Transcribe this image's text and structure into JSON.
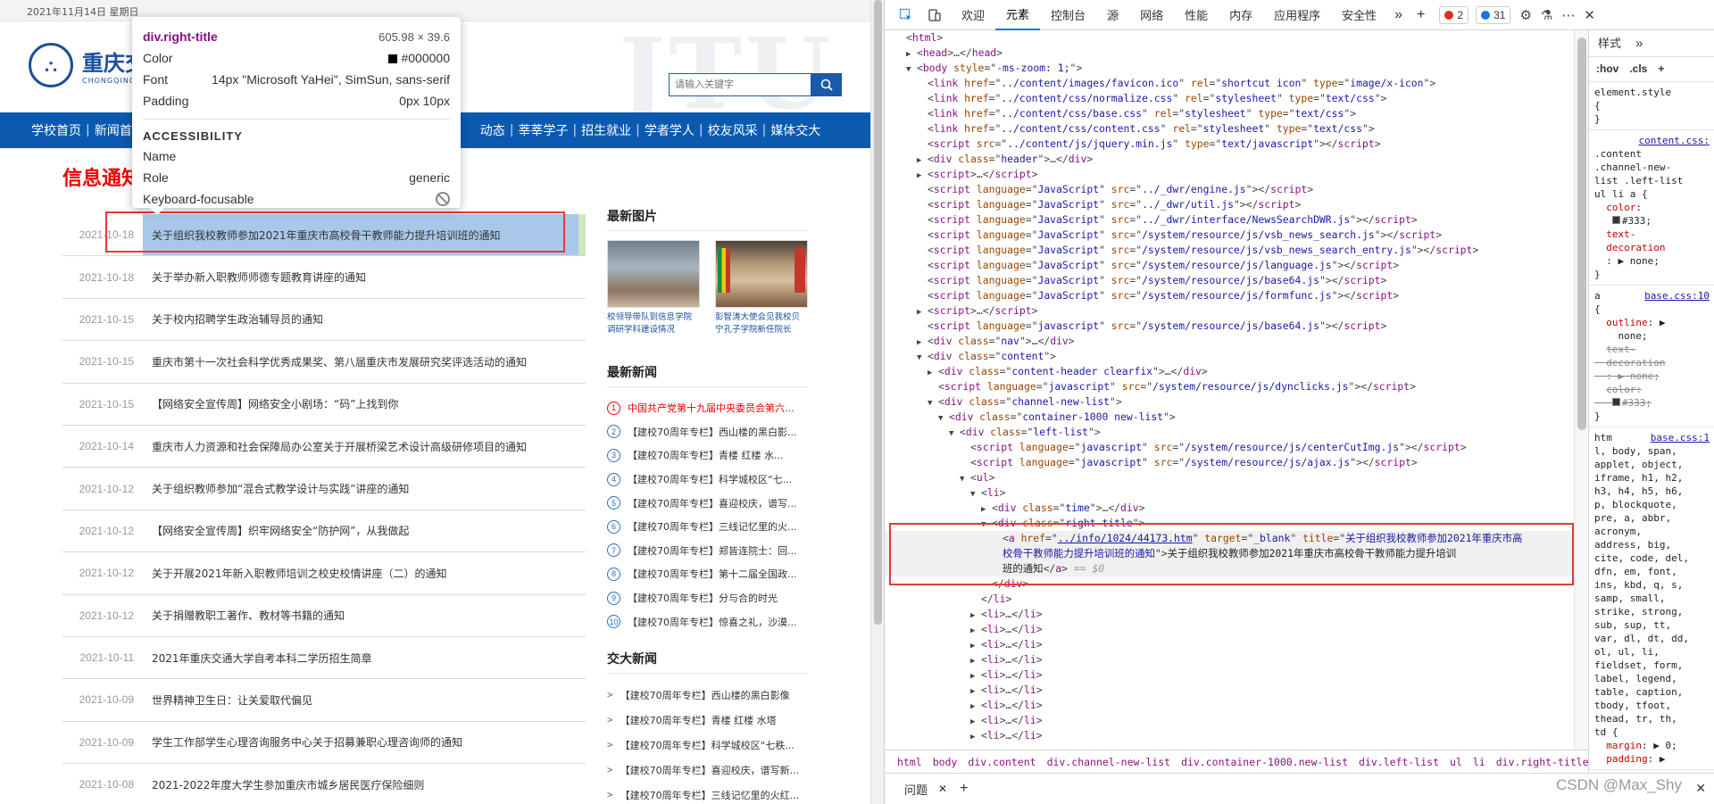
{
  "site": {
    "date": "2021年11月14日 星期日",
    "logo_cn": "重庆交通大学",
    "logo_en": "CHONGQING JIAOTONG UNIVERSITY",
    "bgtext": "JTU",
    "search_placeholder": "请输入关键字",
    "nav": [
      "学校首页",
      "新闻首页",
      "动态",
      "莘莘学子",
      "招生就业",
      "学者学人",
      "校友风采",
      "媒体交大"
    ],
    "section_title": "信息通知",
    "list": [
      {
        "time": "2021-10-18",
        "title": "关于组织我校教师参加2021年重庆市高校骨干教师能力提升培训班的通知"
      },
      {
        "time": "2021-10-18",
        "title": "关于举办新入职教师师德专题教育讲座的通知"
      },
      {
        "time": "2021-10-15",
        "title": "关于校内招聘学生政治辅导员的通知"
      },
      {
        "time": "2021-10-15",
        "title": "重庆市第十一次社会科学优秀成果奖、第八届重庆市发展研究奖评选活动的通知"
      },
      {
        "time": "2021-10-15",
        "title": "【网络安全宣传周】网络安全小剧场：“码”上找到你"
      },
      {
        "time": "2021-10-14",
        "title": "重庆市人力资源和社会保障局办公室关于开展桥梁艺术设计高级研修项目的通知"
      },
      {
        "time": "2021-10-12",
        "title": "关于组织教师参加“混合式教学设计与实践”讲座的通知"
      },
      {
        "time": "2021-10-12",
        "title": "【网络安全宣传周】织牢网络安全“防护网”，从我做起"
      },
      {
        "time": "2021-10-12",
        "title": "关于开展2021年新入职教师培训之校史校情讲座（二）的通知"
      },
      {
        "time": "2021-10-12",
        "title": "关于捐赠教职工著作、教材等书籍的通知"
      },
      {
        "time": "2021-10-11",
        "title": "2021年重庆交通大学自考本科二学历招生简章"
      },
      {
        "time": "2021-10-09",
        "title": "世界精神卫生日：让关爱取代偏见"
      },
      {
        "time": "2021-10-09",
        "title": "学生工作部学生心理咨询服务中心关于招募兼职心理咨询师的通知"
      },
      {
        "time": "2021-10-08",
        "title": "2021-2022年度大学生参加重庆市城乡居民医疗保险细则"
      }
    ],
    "pics_title": "最新图片",
    "pics": [
      {
        "caption": "校领导带队到信息学院调研学科建设情况"
      },
      {
        "caption": "彭智涛大使会见我校贝宁孔子学院新任院长"
      }
    ],
    "news_title": "最新新闻",
    "news": [
      {
        "num": "1",
        "text": "中国共产党第十九届中央委员会第六..."
      },
      {
        "num": "2",
        "text": "【建校70周年专栏】西山楼的黑白影..."
      },
      {
        "num": "3",
        "text": "【建校70周年专栏】青楼 红楼 水..."
      },
      {
        "num": "4",
        "text": "【建校70周年专栏】科学城校区“七..."
      },
      {
        "num": "5",
        "text": "【建校70周年专栏】喜迎校庆，谱写..."
      },
      {
        "num": "6",
        "text": "【建校70周年专栏】三线记忆里的火..."
      },
      {
        "num": "7",
        "text": "【建校70周年专栏】郑皆连院士：回..."
      },
      {
        "num": "8",
        "text": "【建校70周年专栏】第十二届全国政..."
      },
      {
        "num": "9",
        "text": "【建校70周年专栏】分与合的时光"
      },
      {
        "num": "10",
        "text": "【建校70周年专栏】惊喜之礼，沙漠..."
      }
    ],
    "jd_title": "交大新闻",
    "jd": [
      "【建校70周年专栏】西山楼的黑白影像",
      "【建校70周年专栏】青楼 红楼 水塔",
      "【建校70周年专栏】科学城校区“七秩...",
      "【建校70周年专栏】喜迎校庆，谱写新...",
      "【建校70周年专栏】三线记忆里的火红..."
    ]
  },
  "tooltip": {
    "tag": "div.right-title",
    "dims": "605.98 × 39.6",
    "color_label": "Color",
    "color_value": "#000000",
    "font_label": "Font",
    "font_value": "14px \"Microsoft YaHei\", SimSun, sans-serif",
    "padding_label": "Padding",
    "padding_value": "0px 10px",
    "acc_title": "ACCESSIBILITY",
    "name_label": "Name",
    "role_label": "Role",
    "role_value": "generic",
    "kf_label": "Keyboard-focusable"
  },
  "devtools": {
    "tabs": [
      "欢迎",
      "元素",
      "控制台",
      "源",
      "网络",
      "性能",
      "内存",
      "应用程序",
      "安全性"
    ],
    "active_tab": "元素",
    "errors": "2",
    "messages": "31",
    "styles_tab": "样式",
    "filters": [
      ":hov",
      ".cls"
    ],
    "breadcrumbs": [
      "html",
      "body",
      "div.content",
      "div.channel-new-list",
      "div.container-1000.new-list",
      "div.left-list",
      "ul",
      "li",
      "div.right-title",
      "a"
    ],
    "drawer_tab": "问题",
    "watermark": "CSDN @Max_Shy",
    "dom": [
      {
        "i": 0,
        "h": "&lt;<span class='tagn'>html</span>&gt;"
      },
      {
        "i": 1,
        "t": "▶",
        "h": "&lt;<span class='tagn'>head</span>&gt;…&lt;/<span class='tagn'>head</span>&gt;"
      },
      {
        "i": 1,
        "t": "▼",
        "h": "&lt;<span class='tagn'>body</span> <span class='attr'>style</span>=\"<span class='val'>-ms-zoom: 1;</span>\"&gt;"
      },
      {
        "i": 2,
        "h": "&lt;<span class='tagn'>link</span> <span class='attr'>href</span>=\"<span class='val'>../content/images/favicon.ico</span>\" <span class='attr'>rel</span>=\"<span class='val'>shortcut icon</span>\" <span class='attr'>type</span>=\"<span class='val'>image/x-icon</span>\"&gt;"
      },
      {
        "i": 2,
        "h": "&lt;<span class='tagn'>link</span> <span class='attr'>href</span>=\"<span class='val'>../content/css/normalize.css</span>\" <span class='attr'>rel</span>=\"<span class='val'>stylesheet</span>\" <span class='attr'>type</span>=\"<span class='val'>text/css</span>\"&gt;"
      },
      {
        "i": 2,
        "h": "&lt;<span class='tagn'>link</span> <span class='attr'>href</span>=\"<span class='val'>../content/css/base.css</span>\" <span class='attr'>rel</span>=\"<span class='val'>stylesheet</span>\" <span class='attr'>type</span>=\"<span class='val'>text/css</span>\"&gt;"
      },
      {
        "i": 2,
        "h": "&lt;<span class='tagn'>link</span> <span class='attr'>href</span>=\"<span class='val'>../content/css/content.css</span>\" <span class='attr'>rel</span>=\"<span class='val'>stylesheet</span>\" <span class='attr'>type</span>=\"<span class='val'>text/css</span>\"&gt;"
      },
      {
        "i": 2,
        "h": "&lt;<span class='tagn'>script</span> <span class='attr'>src</span>=\"<span class='val'>../content/js/jquery.min.js</span>\" <span class='attr'>type</span>=\"<span class='val'>text/javascript</span>\"&gt;&lt;/<span class='tagn'>script</span>&gt;"
      },
      {
        "i": 2,
        "t": "▶",
        "h": "&lt;<span class='tagn'>div</span> <span class='attr'>class</span>=\"<span class='val'>header</span>\"&gt;…&lt;/<span class='tagn'>div</span>&gt;"
      },
      {
        "i": 2,
        "t": "▶",
        "h": "&lt;<span class='tagn'>script</span>&gt;…&lt;/<span class='tagn'>script</span>&gt;"
      },
      {
        "i": 2,
        "h": "&lt;<span class='tagn'>script</span> <span class='attr'>language</span>=\"<span class='val'>JavaScript</span>\" <span class='attr'>src</span>=\"<span class='val'>../_dwr/engine.js</span>\"&gt;&lt;/<span class='tagn'>script</span>&gt;"
      },
      {
        "i": 2,
        "h": "&lt;<span class='tagn'>script</span> <span class='attr'>language</span>=\"<span class='val'>JavaScript</span>\" <span class='attr'>src</span>=\"<span class='val'>../_dwr/util.js</span>\"&gt;&lt;/<span class='tagn'>script</span>&gt;"
      },
      {
        "i": 2,
        "h": "&lt;<span class='tagn'>script</span> <span class='attr'>language</span>=\"<span class='val'>JavaScript</span>\" <span class='attr'>src</span>=\"<span class='val'>../_dwr/interface/NewsSearchDWR.js</span>\"&gt;&lt;/<span class='tagn'>script</span>&gt;"
      },
      {
        "i": 2,
        "h": "&lt;<span class='tagn'>script</span> <span class='attr'>language</span>=\"<span class='val'>JavaScript</span>\" <span class='attr'>src</span>=\"<span class='val'>/system/resource/js/vsb_news_search.js</span>\"&gt;&lt;/<span class='tagn'>script</span>&gt;"
      },
      {
        "i": 2,
        "h": "&lt;<span class='tagn'>script</span> <span class='attr'>language</span>=\"<span class='val'>JavaScript</span>\" <span class='attr'>src</span>=\"<span class='val'>/system/resource/js/vsb_news_search_entry.js</span>\"&gt;&lt;/<span class='tagn'>script</span>&gt;"
      },
      {
        "i": 2,
        "h": "&lt;<span class='tagn'>script</span> <span class='attr'>language</span>=\"<span class='val'>JavaScript</span>\" <span class='attr'>src</span>=\"<span class='val'>/system/resource/js/language.js</span>\"&gt;&lt;/<span class='tagn'>script</span>&gt;"
      },
      {
        "i": 2,
        "h": "&lt;<span class='tagn'>script</span> <span class='attr'>language</span>=\"<span class='val'>JavaScript</span>\" <span class='attr'>src</span>=\"<span class='val'>/system/resource/js/base64.js</span>\"&gt;&lt;/<span class='tagn'>script</span>&gt;"
      },
      {
        "i": 2,
        "h": "&lt;<span class='tagn'>script</span> <span class='attr'>language</span>=\"<span class='val'>JavaScript</span>\" <span class='attr'>src</span>=\"<span class='val'>/system/resource/js/formfunc.js</span>\"&gt;&lt;/<span class='tagn'>script</span>&gt;"
      },
      {
        "i": 2,
        "t": "▶",
        "h": "&lt;<span class='tagn'>script</span>&gt;…&lt;/<span class='tagn'>script</span>&gt;"
      },
      {
        "i": 2,
        "h": "&lt;<span class='tagn'>script</span> <span class='attr'>language</span>=\"<span class='val'>javascript</span>\" <span class='attr'>src</span>=\"<span class='val'>/system/resource/js/base64.js</span>\"&gt;&lt;/<span class='tagn'>script</span>&gt;"
      },
      {
        "i": 2,
        "t": "▶",
        "h": "&lt;<span class='tagn'>div</span> <span class='attr'>class</span>=\"<span class='val'>nav</span>\"&gt;…&lt;/<span class='tagn'>div</span>&gt;"
      },
      {
        "i": 2,
        "t": "▼",
        "h": "&lt;<span class='tagn'>div</span> <span class='attr'>class</span>=\"<span class='val'>content</span>\"&gt;"
      },
      {
        "i": 3,
        "t": "▶",
        "h": "&lt;<span class='tagn'>div</span> <span class='attr'>class</span>=\"<span class='val'>content-header clearfix</span>\"&gt;…&lt;/<span class='tagn'>div</span>&gt;"
      },
      {
        "i": 3,
        "h": "&lt;<span class='tagn'>script</span> <span class='attr'>language</span>=\"<span class='val'>javascript</span>\" <span class='attr'>src</span>=\"<span class='val'>/system/resource/js/dynclicks.js</span>\"&gt;&lt;/<span class='tagn'>script</span>&gt;"
      },
      {
        "i": 3,
        "t": "▼",
        "h": "&lt;<span class='tagn'>div</span> <span class='attr'>class</span>=\"<span class='val'>channel-new-list</span>\"&gt;"
      },
      {
        "i": 4,
        "t": "▼",
        "h": "&lt;<span class='tagn'>div</span> <span class='attr'>class</span>=\"<span class='val'>container-1000 new-list</span>\"&gt;"
      },
      {
        "i": 5,
        "t": "▼",
        "h": "&lt;<span class='tagn'>div</span> <span class='attr'>class</span>=\"<span class='val'>left-list</span>\"&gt;"
      },
      {
        "i": 6,
        "h": "&lt;<span class='tagn'>script</span> <span class='attr'>language</span>=\"<span class='val'>javascript</span>\" <span class='attr'>src</span>=\"<span class='val'>/system/resource/js/centerCutImg.js</span>\"&gt;&lt;/<span class='tagn'>script</span>&gt;"
      },
      {
        "i": 6,
        "h": "&lt;<span class='tagn'>script</span> <span class='attr'>language</span>=\"<span class='val'>javascript</span>\" <span class='attr'>src</span>=\"<span class='val'>/system/resource/js/ajax.js</span>\"&gt;&lt;/<span class='tagn'>script</span>&gt;"
      },
      {
        "i": 6,
        "t": "▼",
        "h": "&lt;<span class='tagn'>ul</span>&gt;"
      },
      {
        "i": 7,
        "t": "▼",
        "h": "&lt;<span class='tagn'>li</span>&gt;"
      },
      {
        "i": 8,
        "t": "▶",
        "h": "&lt;<span class='tagn'>div</span> <span class='attr'>class</span>=\"<span class='val'>time</span>\"&gt;…&lt;/<span class='tagn'>div</span>&gt;"
      },
      {
        "i": 8,
        "t": "▼",
        "h": "&lt;<span class='tagn'>div</span> <span class='attr'>class</span>=\"<span class='val'>right-title</span>\"&gt;"
      },
      {
        "i": 9,
        "sel": true,
        "h": "&lt;<span class='tagn'>a</span> <span class='attr'>href</span>=\"<span class='url'>../info/1024/44173.htm</span>\" <span class='attr'>target</span>=\"<span class='val'>_blank</span>\" <span class='attr'>title</span>=\"<span class='val'>关于组织我校教师参加2021年重庆市高</span>"
      },
      {
        "i": 9,
        "sel": true,
        "h": "<span class='val'>校骨干教师能力提升培训班的通知</span>\"&gt;<span class='txt'>关于组织我校教师参加2021年重庆市高校骨干教师能力提升培训</span>"
      },
      {
        "i": 9,
        "sel": true,
        "h": "<span class='txt'>班的通知</span>&lt;/<span class='tagn'>a</span>&gt; <span class='eq'>== $0</span>"
      },
      {
        "i": 8,
        "h": "&lt;/<span class='tagn'>div</span>&gt;"
      },
      {
        "i": 7,
        "h": "&lt;/<span class='tagn'>li</span>&gt;"
      },
      {
        "i": 7,
        "t": "▶",
        "h": "&lt;<span class='tagn'>li</span>&gt;…&lt;/<span class='tagn'>li</span>&gt;"
      },
      {
        "i": 7,
        "t": "▶",
        "h": "&lt;<span class='tagn'>li</span>&gt;…&lt;/<span class='tagn'>li</span>&gt;"
      },
      {
        "i": 7,
        "t": "▶",
        "h": "&lt;<span class='tagn'>li</span>&gt;…&lt;/<span class='tagn'>li</span>&gt;"
      },
      {
        "i": 7,
        "t": "▶",
        "h": "&lt;<span class='tagn'>li</span>&gt;…&lt;/<span class='tagn'>li</span>&gt;"
      },
      {
        "i": 7,
        "t": "▶",
        "h": "&lt;<span class='tagn'>li</span>&gt;…&lt;/<span class='tagn'>li</span>&gt;"
      },
      {
        "i": 7,
        "t": "▶",
        "h": "&lt;<span class='tagn'>li</span>&gt;…&lt;/<span class='tagn'>li</span>&gt;"
      },
      {
        "i": 7,
        "t": "▶",
        "h": "&lt;<span class='tagn'>li</span>&gt;…&lt;/<span class='tagn'>li</span>&gt;"
      },
      {
        "i": 7,
        "t": "▶",
        "h": "&lt;<span class='tagn'>li</span>&gt;…&lt;/<span class='tagn'>li</span>&gt;"
      },
      {
        "i": 7,
        "t": "▶",
        "h": "&lt;<span class='tagn'>li</span>&gt;…&lt;/<span class='tagn'>li</span>&gt;"
      }
    ]
  }
}
